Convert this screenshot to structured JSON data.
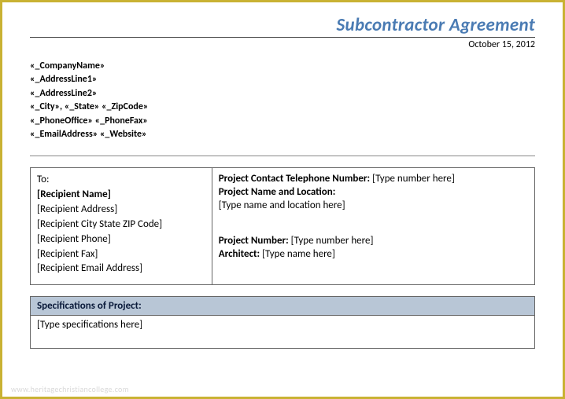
{
  "header": {
    "title": "Subcontractor Agreement",
    "date": "October 15, 2012"
  },
  "company": {
    "name": "«_CompanyName»",
    "address1": "«_AddressLine1»",
    "address2": "«_AddressLine2»",
    "city": "«_City»",
    "state": "«_State»",
    "zip": "«_ZipCode»",
    "phone_office": "«_PhoneOffice»",
    "phone_fax": "«_PhoneFax»",
    "email": "«_EmailAddress»",
    "website": "«_Website»"
  },
  "recipient": {
    "to_label": "To:",
    "name": "[Recipient Name]",
    "address": "[Recipient Address]",
    "city_state_zip": "[Recipient City State ZIP Code]",
    "phone": "[Recipient Phone]",
    "fax": "[Recipient Fax]",
    "email": "[Recipient Email Address]"
  },
  "project": {
    "contact_phone_label": "Project Contact Telephone Number:",
    "contact_phone_value": "[Type number here]",
    "name_location_label": "Project Name and Location:",
    "name_location_value": "[Type name and location here]",
    "number_label": "Project Number:",
    "number_value": "[Type number here]",
    "architect_label": "Architect:",
    "architect_value": "[Type name here]"
  },
  "specifications": {
    "header": "Specifications of Project:",
    "body": "[Type specifications here]"
  },
  "watermark": "www.heritagechristiancollege.com"
}
